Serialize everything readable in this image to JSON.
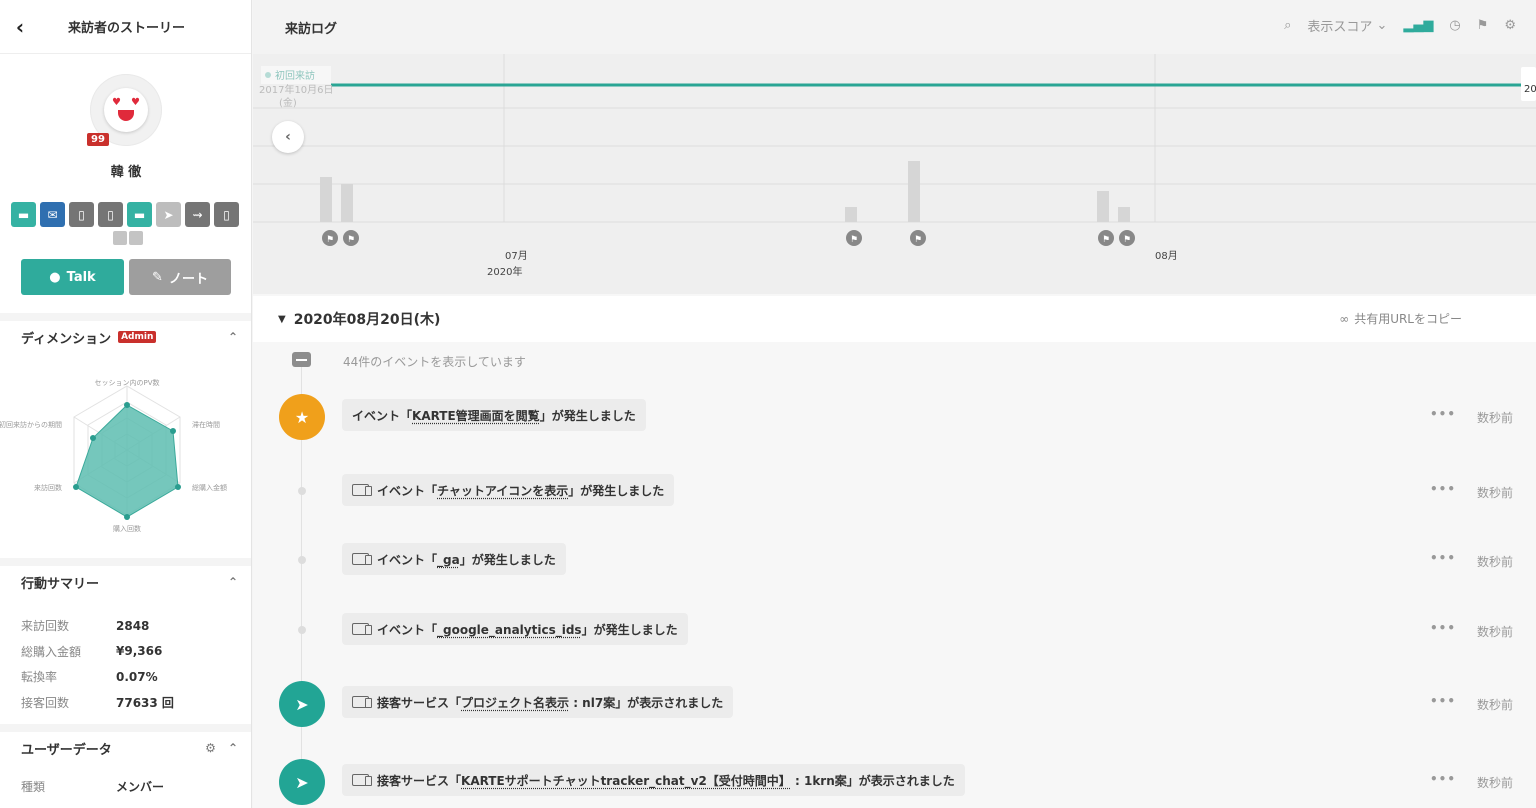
{
  "left": {
    "title": "来訪者のストーリー",
    "back_icon": "chevron-left-icon",
    "score_badge": "99",
    "user_name": "韓 徹",
    "channels": [
      {
        "icon": "chat-icon",
        "color": "#35b2a3"
      },
      {
        "icon": "mail-icon",
        "color": "#2f6fb0"
      },
      {
        "icon": "mobile-icon",
        "color": "#757575"
      },
      {
        "icon": "mobile-icon",
        "color": "#757575"
      },
      {
        "icon": "chat-icon",
        "color": "#35b2a3"
      },
      {
        "icon": "send-icon",
        "color": "#bdbdbd"
      },
      {
        "icon": "messenger-icon",
        "color": "#757575"
      },
      {
        "icon": "mobile-icon",
        "color": "#757575"
      }
    ],
    "talk_label": "Talk",
    "note_label": "ノート",
    "dimension": {
      "title": "ディメンション",
      "badge": "Admin",
      "radar_labels": [
        "セッション内のPV数",
        "滞在時間",
        "総購入金額",
        "購入回数",
        "来訪回数",
        "初回来訪からの期間"
      ]
    },
    "summary": {
      "title": "行動サマリー",
      "rows": [
        {
          "label": "来訪回数",
          "value": "2848"
        },
        {
          "label": "総購入金額",
          "value": "¥9,366"
        },
        {
          "label": "転換率",
          "value": "0.07%"
        },
        {
          "label": "接客回数",
          "value": "77633 回"
        }
      ]
    },
    "userdata": {
      "title": "ユーザーデータ",
      "rows": [
        {
          "label": "種類",
          "value": "メンバー"
        }
      ]
    }
  },
  "right": {
    "title": "来訪ログ",
    "score_label": "表示スコア",
    "timeline": {
      "first_visit_label": "初回来訪",
      "first_visit_date": "2017年10月6日",
      "first_visit_day": "(金)",
      "month1": "07月",
      "year1": "2020年",
      "month2": "08月",
      "right_edge": "20"
    },
    "date": "2020年08月20日(木)",
    "copy_url": "共有用URLをコピー",
    "event_count": "44件のイベントを表示しています",
    "events": [
      {
        "type": "star",
        "pre": "イベント「",
        "name": "KARTE管理画面を閲覧",
        "post": "」が発生しました",
        "ago": "数秒前"
      },
      {
        "type": "dot",
        "pre": "イベント「",
        "name": "チャットアイコンを表示",
        "post": "」が発生しました",
        "ago": "数秒前"
      },
      {
        "type": "dot",
        "pre": "イベント「",
        "name": "_ga",
        "post": "」が発生しました",
        "ago": "数秒前"
      },
      {
        "type": "dot",
        "pre": "イベント「",
        "name": "_google_analytics_ids",
        "post": "」が発生しました",
        "ago": "数秒前"
      },
      {
        "type": "send",
        "pre": "接客サービス「",
        "name": "プロジェクト名表示",
        "post": " : nl7案」が表示されました",
        "ago": "数秒前"
      },
      {
        "type": "send",
        "pre": "接客サービス「",
        "name": "KARTEサポートチャットtracker_chat_v2【受付時間中】",
        "post": " : 1krn案」が表示されました",
        "ago": "数秒前"
      }
    ]
  }
}
